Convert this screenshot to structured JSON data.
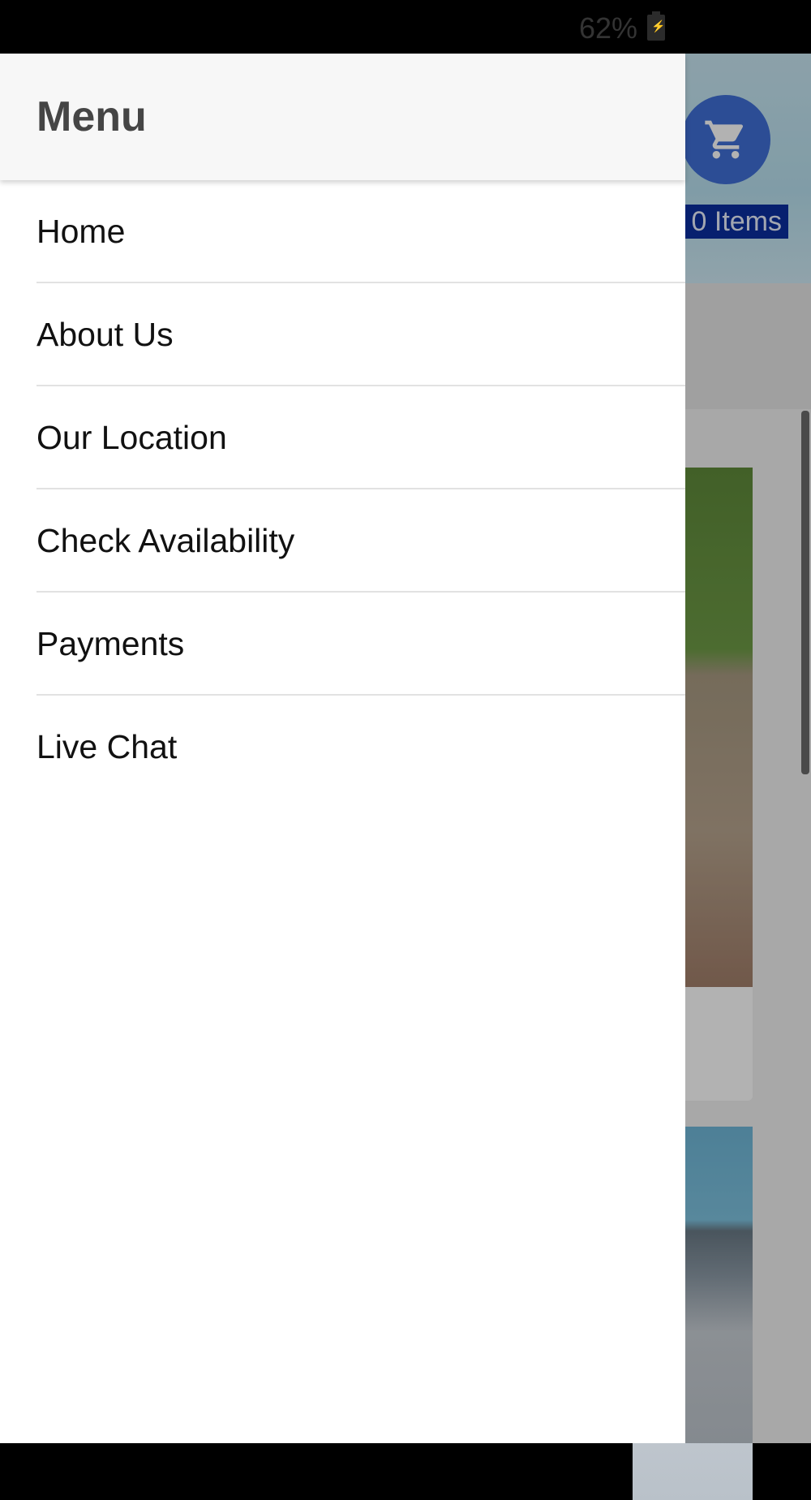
{
  "status_bar": {
    "battery_percent": "62%",
    "battery_icon": "battery-charging-icon"
  },
  "drawer": {
    "title": "Menu",
    "items": [
      {
        "label": "Home"
      },
      {
        "label": "About Us"
      },
      {
        "label": "Our Location"
      },
      {
        "label": "Check Availability"
      },
      {
        "label": "Payments"
      },
      {
        "label": "Live Chat"
      }
    ]
  },
  "background_app": {
    "cart_icon": "shopping-cart-icon",
    "cart_label": "0 Items",
    "accent_color": "#3f6fd6",
    "cart_label_bg": "#0b2ea0"
  }
}
